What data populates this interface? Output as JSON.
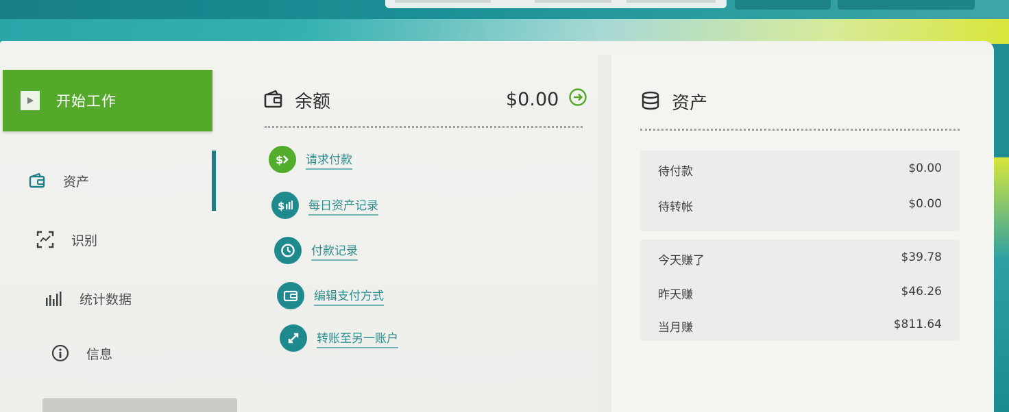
{
  "sidebar": {
    "start_label": "开始工作",
    "items": [
      {
        "label": "资产",
        "icon": "wallet-icon"
      },
      {
        "label": "识别",
        "icon": "scan-icon"
      },
      {
        "label": "统计数据",
        "icon": "bar-chart-icon"
      },
      {
        "label": "信息",
        "icon": "info-icon"
      }
    ]
  },
  "balance": {
    "title": "余额",
    "amount": "$0.00",
    "actions": [
      {
        "label": "请求付款",
        "icon": "dollar-request-icon",
        "color": "#52ad2c"
      },
      {
        "label": "每日资产记录",
        "icon": "dollar-chart-icon",
        "color": "#1f8a8e"
      },
      {
        "label": "付款记录",
        "icon": "history-icon",
        "color": "#1f8a8e"
      },
      {
        "label": "编辑支付方式",
        "icon": "wallet-icon",
        "color": "#1f8a8e"
      },
      {
        "label": "转账至另一账户",
        "icon": "transfer-icon",
        "color": "#1f8a8e"
      }
    ]
  },
  "assets": {
    "title": "资产",
    "pending": [
      {
        "label": "待付款",
        "value": "$0.00"
      },
      {
        "label": "待转帐",
        "value": "$0.00"
      }
    ],
    "earnings": [
      {
        "label": "今天赚了",
        "value": "$39.78"
      },
      {
        "label": "昨天赚",
        "value": "$46.26"
      },
      {
        "label": "当月赚",
        "value": "$811.64"
      }
    ]
  },
  "colors": {
    "accent_green": "#54a92b",
    "accent_teal": "#1f8a8e"
  }
}
